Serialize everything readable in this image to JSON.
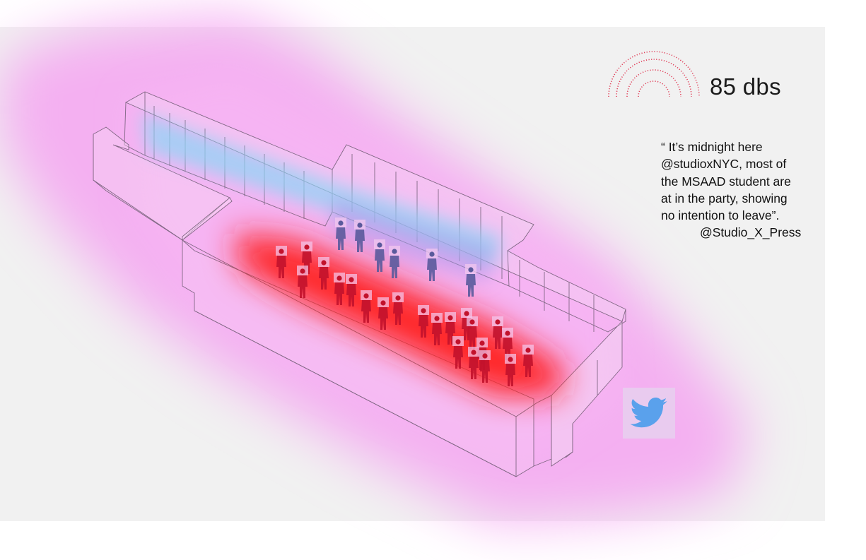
{
  "sound": {
    "level_label": "85 dbs",
    "wave_color": "#e0405a",
    "wave_icon": "sound-wave-arcs-icon"
  },
  "quote": {
    "lines": [
      "“ It’s midnight  here",
      "@studioxNYC, most of",
      "the MSAAD student are",
      "at in the party, showing",
      "no intention to leave”."
    ],
    "attribution": "@Studio_X_Press"
  },
  "social": {
    "icon": "twitter-bird-icon",
    "icon_color": "#5aa1ec",
    "tile_color": "#e9cbef"
  },
  "colors": {
    "background": "#f1f1f1",
    "heat_outer": "#f2a0ef",
    "heat_hot": "#ff1a1a",
    "heat_cool": "#8fd6f5",
    "people_hot": "#c2122c",
    "people_cool": "#5a5a9c"
  }
}
